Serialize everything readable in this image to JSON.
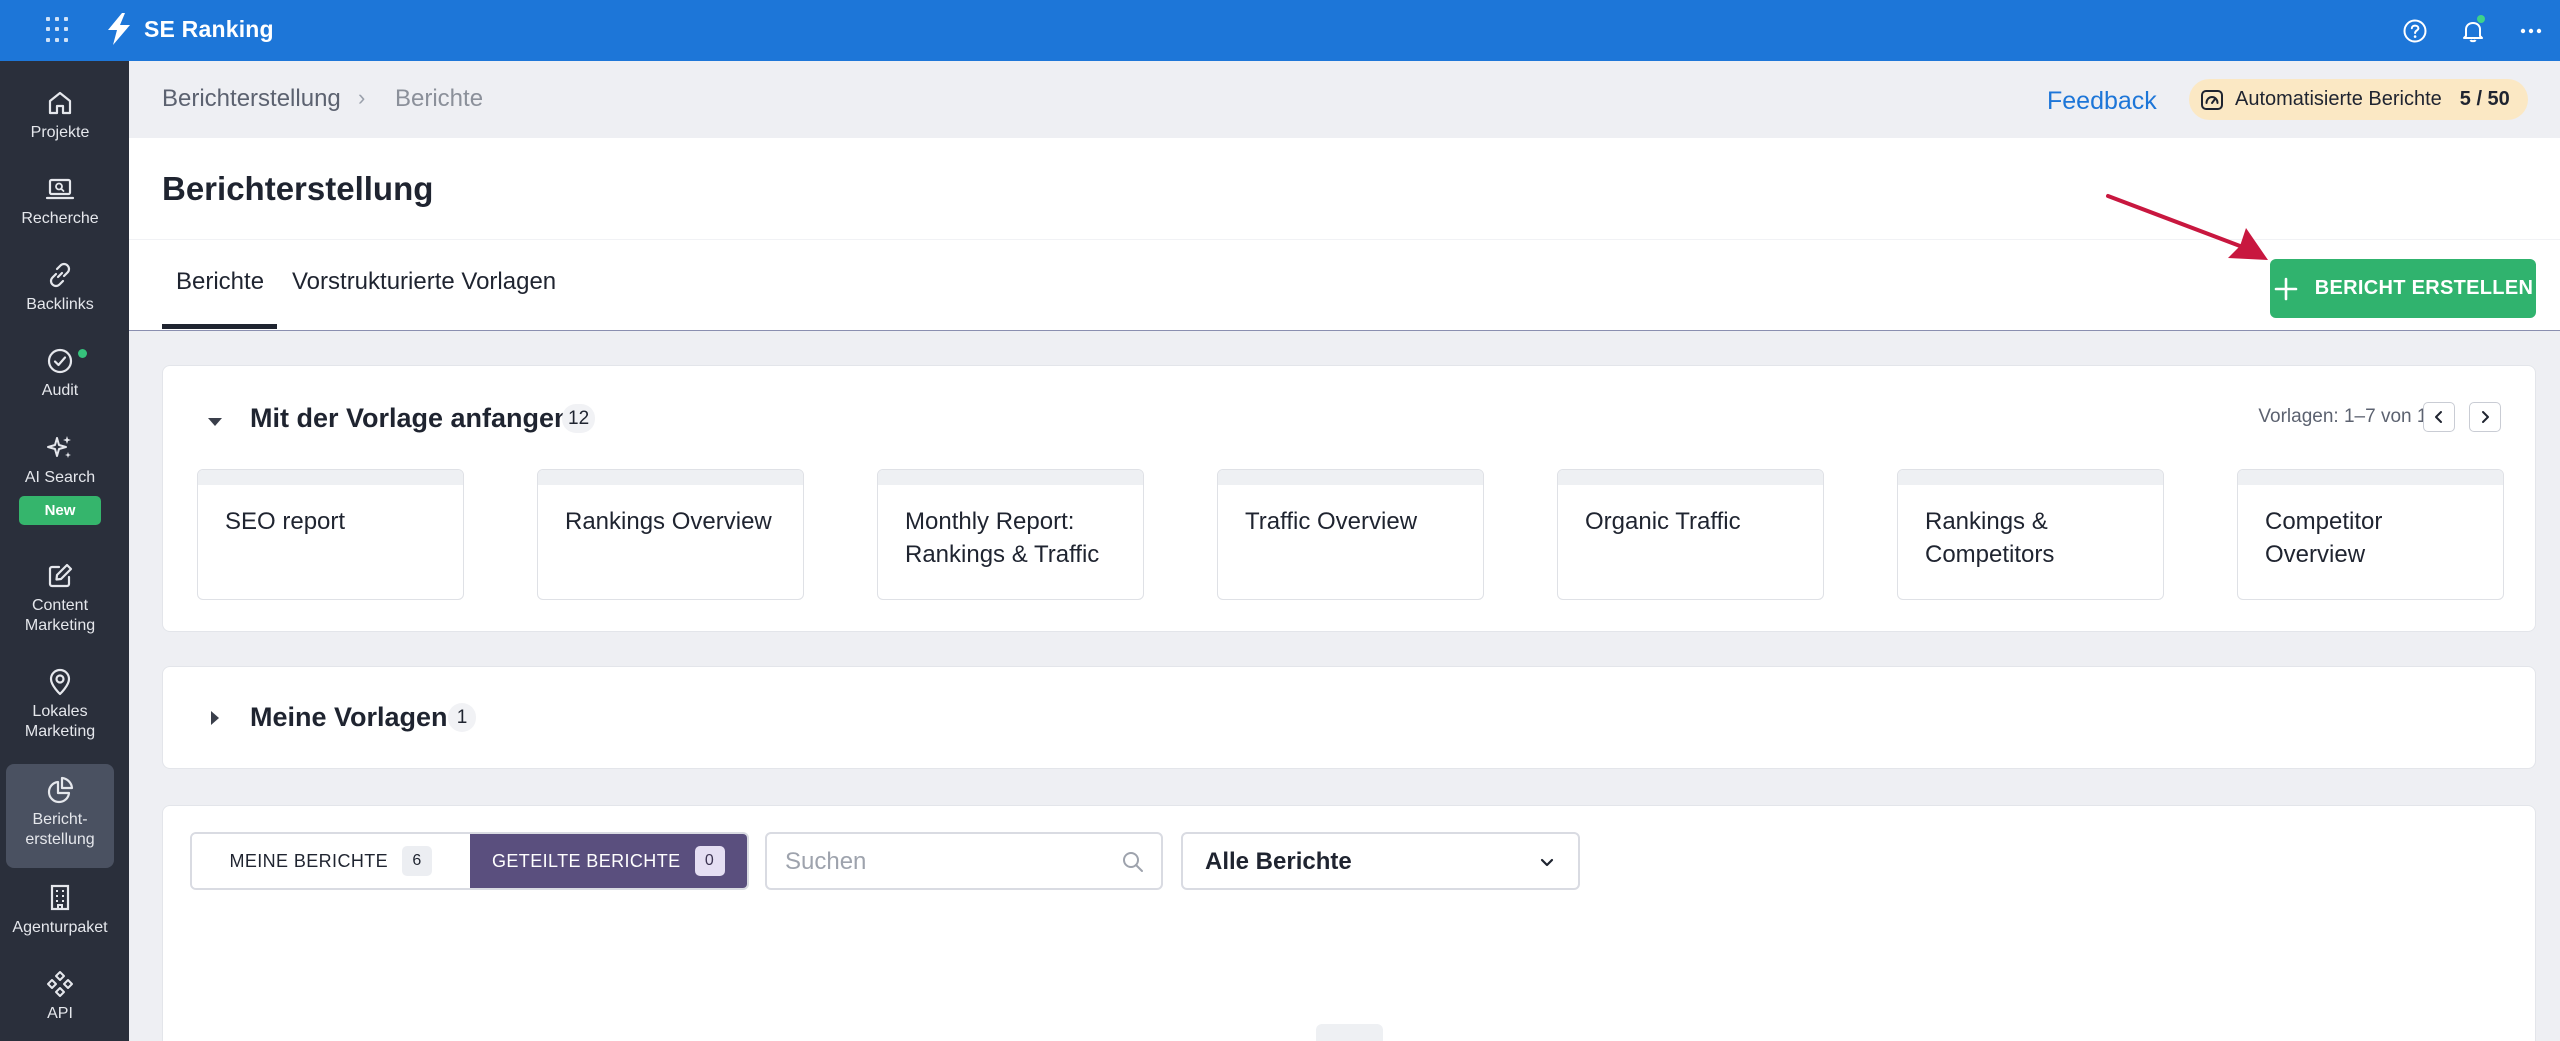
{
  "topbar": {
    "brand": "SE Ranking"
  },
  "sidebar": {
    "items": [
      {
        "label": "Projekte",
        "icon": "home-icon"
      },
      {
        "label": "Recherche",
        "icon": "laptop-search-icon"
      },
      {
        "label": "Backlinks",
        "icon": "link-icon"
      },
      {
        "label": "Audit",
        "icon": "check-circle-icon"
      },
      {
        "label": "AI Search",
        "icon": "sparkles-icon",
        "badge": "New"
      },
      {
        "label": "Content Marketing",
        "icon": "edit-icon"
      },
      {
        "label": "Lokales Marketing",
        "icon": "location-pin-icon"
      },
      {
        "label": "Bericht-erstellung",
        "icon": "pie-chart-icon"
      },
      {
        "label": "Agenturpaket",
        "icon": "building-icon"
      },
      {
        "label": "API",
        "icon": "api-icon"
      }
    ]
  },
  "breadcrumb": {
    "parent": "Berichterstellung",
    "separator": "›",
    "current": "Berichte"
  },
  "feedback": "Feedback",
  "quota": {
    "label": "Automatisierte Berichte",
    "value": "5 / 50"
  },
  "header": {
    "title": "Berichterstellung",
    "tabs": [
      "Berichte",
      "Vorstrukturierte Vorlagen"
    ],
    "create_button": "BERICHT ERSTELLEN"
  },
  "templates_section": {
    "title": "Mit der Vorlage anfangen",
    "count": "12",
    "pager": "Vorlagen: 1–7 von 12",
    "items": [
      "SEO report",
      "Rankings Overview",
      "Monthly Report: Rankings & Traffic",
      "Traffic Overview",
      "Organic Traffic",
      "Rankings & Competitors",
      "Competitor Overview"
    ]
  },
  "my_templates": {
    "title": "Meine Vorlagen",
    "count": "1"
  },
  "reports": {
    "segments": [
      {
        "label": "MEINE BERICHTE",
        "count": "6"
      },
      {
        "label": "GETEILTE BERICHTE",
        "count": "0"
      }
    ],
    "search_placeholder": "Suchen",
    "filter_value": "Alle Berichte"
  },
  "colors": {
    "topbar": "#1d76d8",
    "sidebar": "#2a2f3b",
    "primary_button": "#30b36e",
    "active_segment": "#5a4f7e",
    "annotation_arrow": "#c8173f"
  }
}
